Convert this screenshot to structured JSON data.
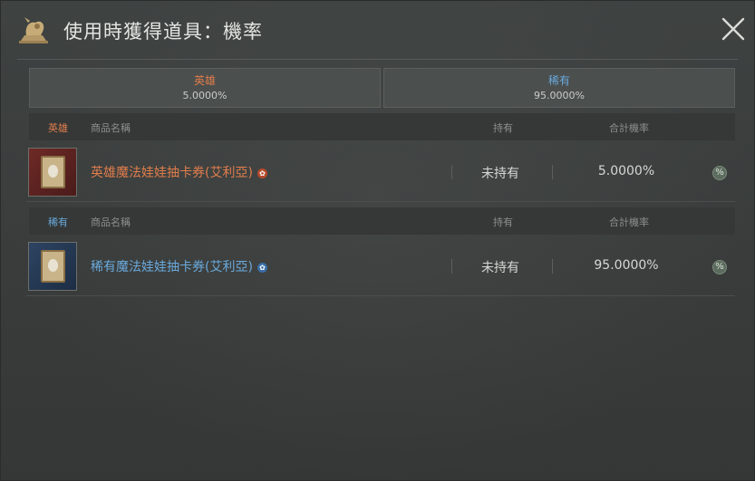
{
  "window": {
    "title": "使用時獲得道具：機率"
  },
  "summary": [
    {
      "grade": "英雄",
      "rate": "5.0000%"
    },
    {
      "grade": "稀有",
      "rate": "95.0000%"
    }
  ],
  "groups": [
    {
      "grade": "英雄",
      "headers": {
        "name": "商品名稱",
        "own": "持有",
        "rate": "合計機率"
      },
      "item": {
        "name": "英雄魔法娃娃抽卡券(艾利亞)",
        "own": "未持有",
        "rate": "5.0000%",
        "badge": "✿"
      }
    },
    {
      "grade": "稀有",
      "headers": {
        "name": "商品名稱",
        "own": "持有",
        "rate": "合計機率"
      },
      "item": {
        "name": "稀有魔法娃娃抽卡券(艾利亞)",
        "own": "未持有",
        "rate": "95.0000%",
        "badge": "✿"
      }
    }
  ],
  "colors": {
    "hero": "#e07d4c",
    "rare": "#6aa9dc"
  },
  "icons": {
    "title": "doll-trophy-icon",
    "close": "close-icon",
    "calc": "percent-icon"
  },
  "calc_glyph": "%"
}
